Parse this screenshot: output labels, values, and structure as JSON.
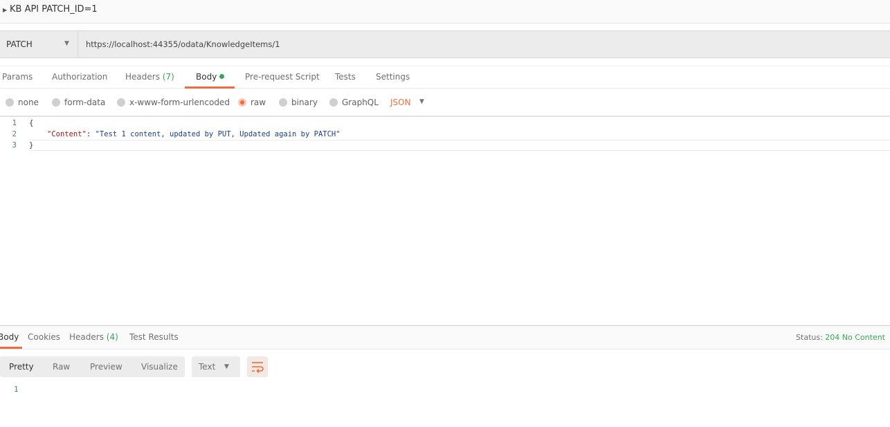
{
  "request": {
    "name": "KB API PATCH_ID=1",
    "method": "PATCH",
    "url": "https://localhost:44355/odata/KnowledgeItems/1"
  },
  "request_tabs": [
    {
      "label": "Params"
    },
    {
      "label": "Authorization"
    },
    {
      "label": "Headers",
      "count": "(7)"
    },
    {
      "label": "Body",
      "active": true
    },
    {
      "label": "Pre-request Script"
    },
    {
      "label": "Tests"
    },
    {
      "label": "Settings"
    }
  ],
  "body_types": [
    {
      "label": "none"
    },
    {
      "label": "form-data"
    },
    {
      "label": "x-www-form-urlencoded"
    },
    {
      "label": "raw",
      "selected": true
    },
    {
      "label": "binary"
    },
    {
      "label": "GraphQL"
    }
  ],
  "raw_format": "JSON",
  "editor": {
    "line_numbers": [
      "1",
      "2",
      "3"
    ],
    "open_brace": "{",
    "key": "\"Content\"",
    "colon": ": ",
    "value": "\"Test 1 content, updated by PUT, Updated again by PATCH\"",
    "close_brace": "}"
  },
  "response_tabs": [
    {
      "label": "Body",
      "active": true
    },
    {
      "label": "Cookies"
    },
    {
      "label": "Headers",
      "count": "(4)"
    },
    {
      "label": "Test Results"
    }
  ],
  "status": {
    "label": "Status:",
    "value": "204 No Content",
    "color": "#3aa655"
  },
  "view_modes": [
    "Pretty",
    "Raw",
    "Preview",
    "Visualize"
  ],
  "response_format": "Text",
  "response_lines": [
    "1"
  ],
  "accent": "#f26b3a"
}
